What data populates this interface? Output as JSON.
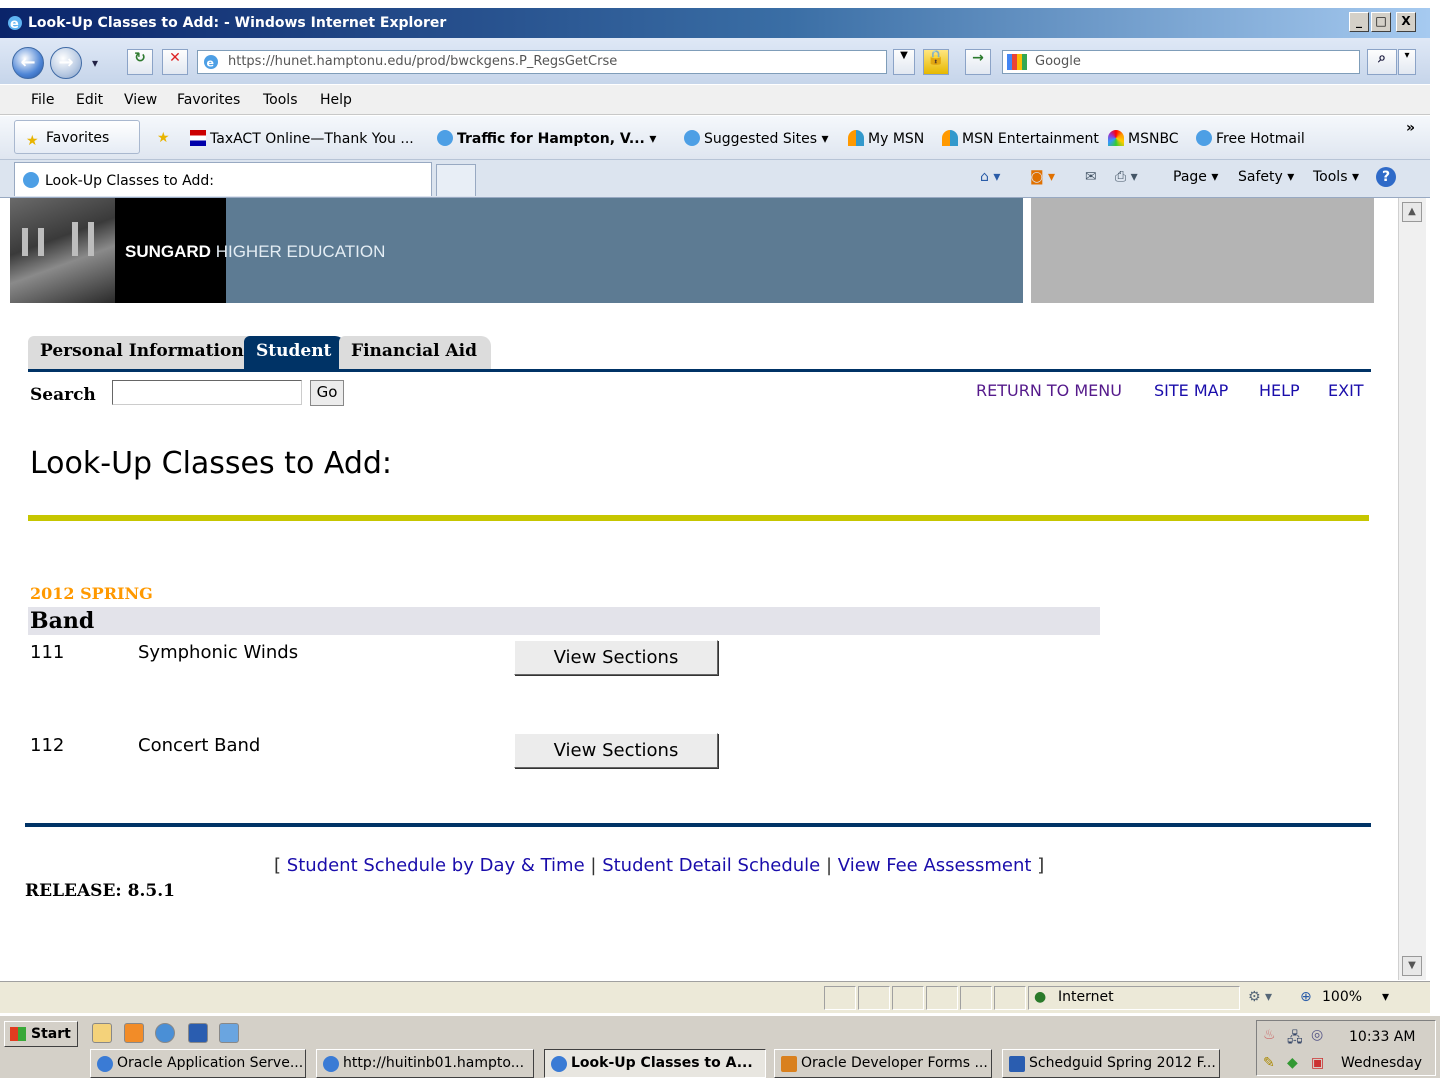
{
  "window": {
    "title": "Look-Up Classes to Add: - Windows Internet Explorer",
    "minimize": "_",
    "maximize": "□",
    "close": "X"
  },
  "address_bar": {
    "url": "https://hunet.hamptonu.edu/prod/bwckgens.P_RegsGetCrse",
    "search_placeholder": "Google"
  },
  "menu": [
    "File",
    "Edit",
    "View",
    "Favorites",
    "Tools",
    "Help"
  ],
  "favorites_bar": {
    "favorites_label": "Favorites",
    "items": [
      "TaxACT Online—Thank You ...",
      "Traffic for Hampton, V...",
      "Suggested Sites ▾",
      "My MSN",
      "MSN Entertainment",
      "MSNBC",
      "Free Hotmail"
    ]
  },
  "browser_tab": {
    "label": "Look-Up Classes to Add:"
  },
  "command_bar": {
    "page": "Page ▾",
    "safety": "Safety ▾",
    "tools": "Tools ▾"
  },
  "banner": {
    "brand_bold": "SUNGARD",
    "brand_light": "HIGHER EDUCATION"
  },
  "nav_tabs": [
    "Personal Information",
    "Student",
    "Financial Aid"
  ],
  "search": {
    "label": "Search",
    "value": "",
    "go_label": "Go"
  },
  "top_links": [
    "RETURN TO MENU",
    "SITE MAP",
    "HELP",
    "EXIT"
  ],
  "page_title": "Look-Up Classes to Add:",
  "term": "2012 SPRING",
  "subject": "Band",
  "courses": [
    {
      "number": "111",
      "title": "Symphonic Winds",
      "button": "View Sections"
    },
    {
      "number": "112",
      "title": "Concert Band",
      "button": "View Sections"
    }
  ],
  "footer": {
    "open_bracket": "[",
    "links": [
      "Student Schedule by Day & Time",
      "Student Detail Schedule",
      "View Fee Assessment"
    ],
    "separator": "|",
    "close_bracket": "]",
    "release": "RELEASE: 8.5.1"
  },
  "status_bar": {
    "zone": "Internet",
    "zoom": "100%"
  },
  "taskbar": {
    "start_label": "Start",
    "tasks": [
      "Oracle Application Serve...",
      "http://huitinb01.hampto...",
      "Look-Up Classes to A...",
      "Oracle Developer Forms ...",
      "Schedguid Spring 2012 F..."
    ],
    "time": "10:33 AM",
    "day": "Wednesday"
  },
  "colors": {
    "banner_blue": "#5d7b93",
    "nav_navy": "#003366",
    "accent_yellow": "#c6c600",
    "term_orange": "#ff9900"
  }
}
